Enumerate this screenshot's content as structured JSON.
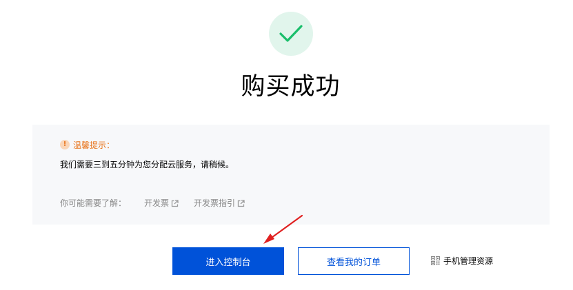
{
  "result": {
    "title": "购买成功",
    "icon": "check-icon",
    "accent_color": "#19be6b"
  },
  "notice": {
    "icon": "exclamation-icon",
    "title": "温馨提示：",
    "message": "我们需要三到五分钟为您分配云服务，请稍候。",
    "related_label": "你可能需要了解：",
    "links": [
      {
        "label": "开发票",
        "icon": "external-link-icon"
      },
      {
        "label": "开发票指引",
        "icon": "external-link-icon"
      }
    ]
  },
  "actions": {
    "console_button": "进入控制台",
    "orders_button": "查看我的订单",
    "mobile_link": "手机管理资源",
    "mobile_icon": "qr-code-icon",
    "primary_color": "#0052d9"
  }
}
